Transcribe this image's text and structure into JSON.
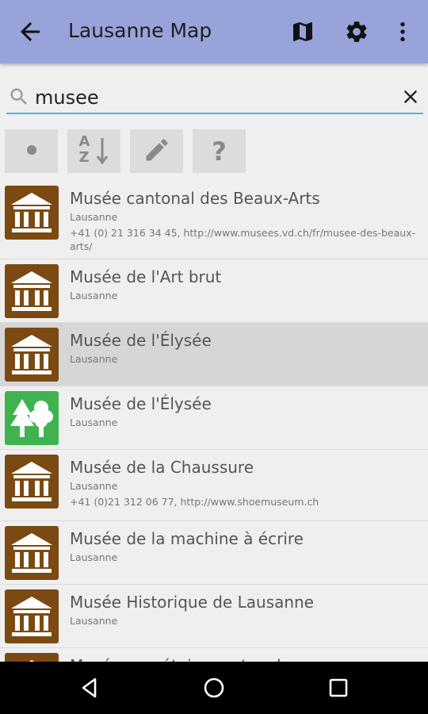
{
  "appbar": {
    "title": "Lausanne Map",
    "icons": [
      "back-arrow-icon",
      "map-icon",
      "gear-icon",
      "overflow-menu-icon"
    ]
  },
  "search": {
    "value": "musee",
    "icons": [
      "search-icon",
      "close-icon"
    ]
  },
  "toolbar": {
    "sort_alpha_top": "A",
    "sort_alpha_bottom": "Z",
    "help": "?",
    "icons": [
      "dot-icon",
      "sort-alpha-icon",
      "edit-pencil-icon",
      "help-icon"
    ]
  },
  "results": [
    {
      "name": "Musée cantonal des Beaux-Arts",
      "city": "Lausanne",
      "info": "+41 (0) 21 316 34 45, http://www.musees.vd.ch/fr/musee-des-beaux-arts/",
      "icon": "museum-icon",
      "color": "#7b4a12"
    },
    {
      "name": "Musée de l'Art brut",
      "city": "Lausanne",
      "info": "",
      "icon": "museum-icon",
      "color": "#7b4a12"
    },
    {
      "name": "Musée de l'Élysée",
      "city": "Lausanne",
      "info": "",
      "icon": "museum-icon",
      "color": "#7b4a12",
      "selected": true
    },
    {
      "name": "Musée de l'Élysée",
      "city": "Lausanne",
      "info": "",
      "icon": "park-trees-icon",
      "color": "#3fb34f"
    },
    {
      "name": "Musée de la Chaussure",
      "city": "Lausanne",
      "info": "+41 (0)21 312 06 77, http://www.shoemuseum.ch",
      "icon": "museum-icon",
      "color": "#7b4a12"
    },
    {
      "name": "Musée de la machine à écrire",
      "city": "Lausanne",
      "info": "",
      "icon": "museum-icon",
      "color": "#7b4a12"
    },
    {
      "name": "Musée Historique de Lausanne",
      "city": "Lausanne",
      "info": "",
      "icon": "museum-icon",
      "color": "#7b4a12"
    },
    {
      "name": "Musée monétaire cantonal",
      "city": "",
      "info": "",
      "icon": "museum-icon",
      "color": "#7b4a12"
    }
  ],
  "navbar": {
    "icons": [
      "nav-back-icon",
      "nav-home-icon",
      "nav-recents-icon"
    ]
  },
  "colors": {
    "appbar": "#97a3d9",
    "search_underline": "#4db6e5",
    "museum": "#7b4a12",
    "park": "#3fb34f"
  }
}
